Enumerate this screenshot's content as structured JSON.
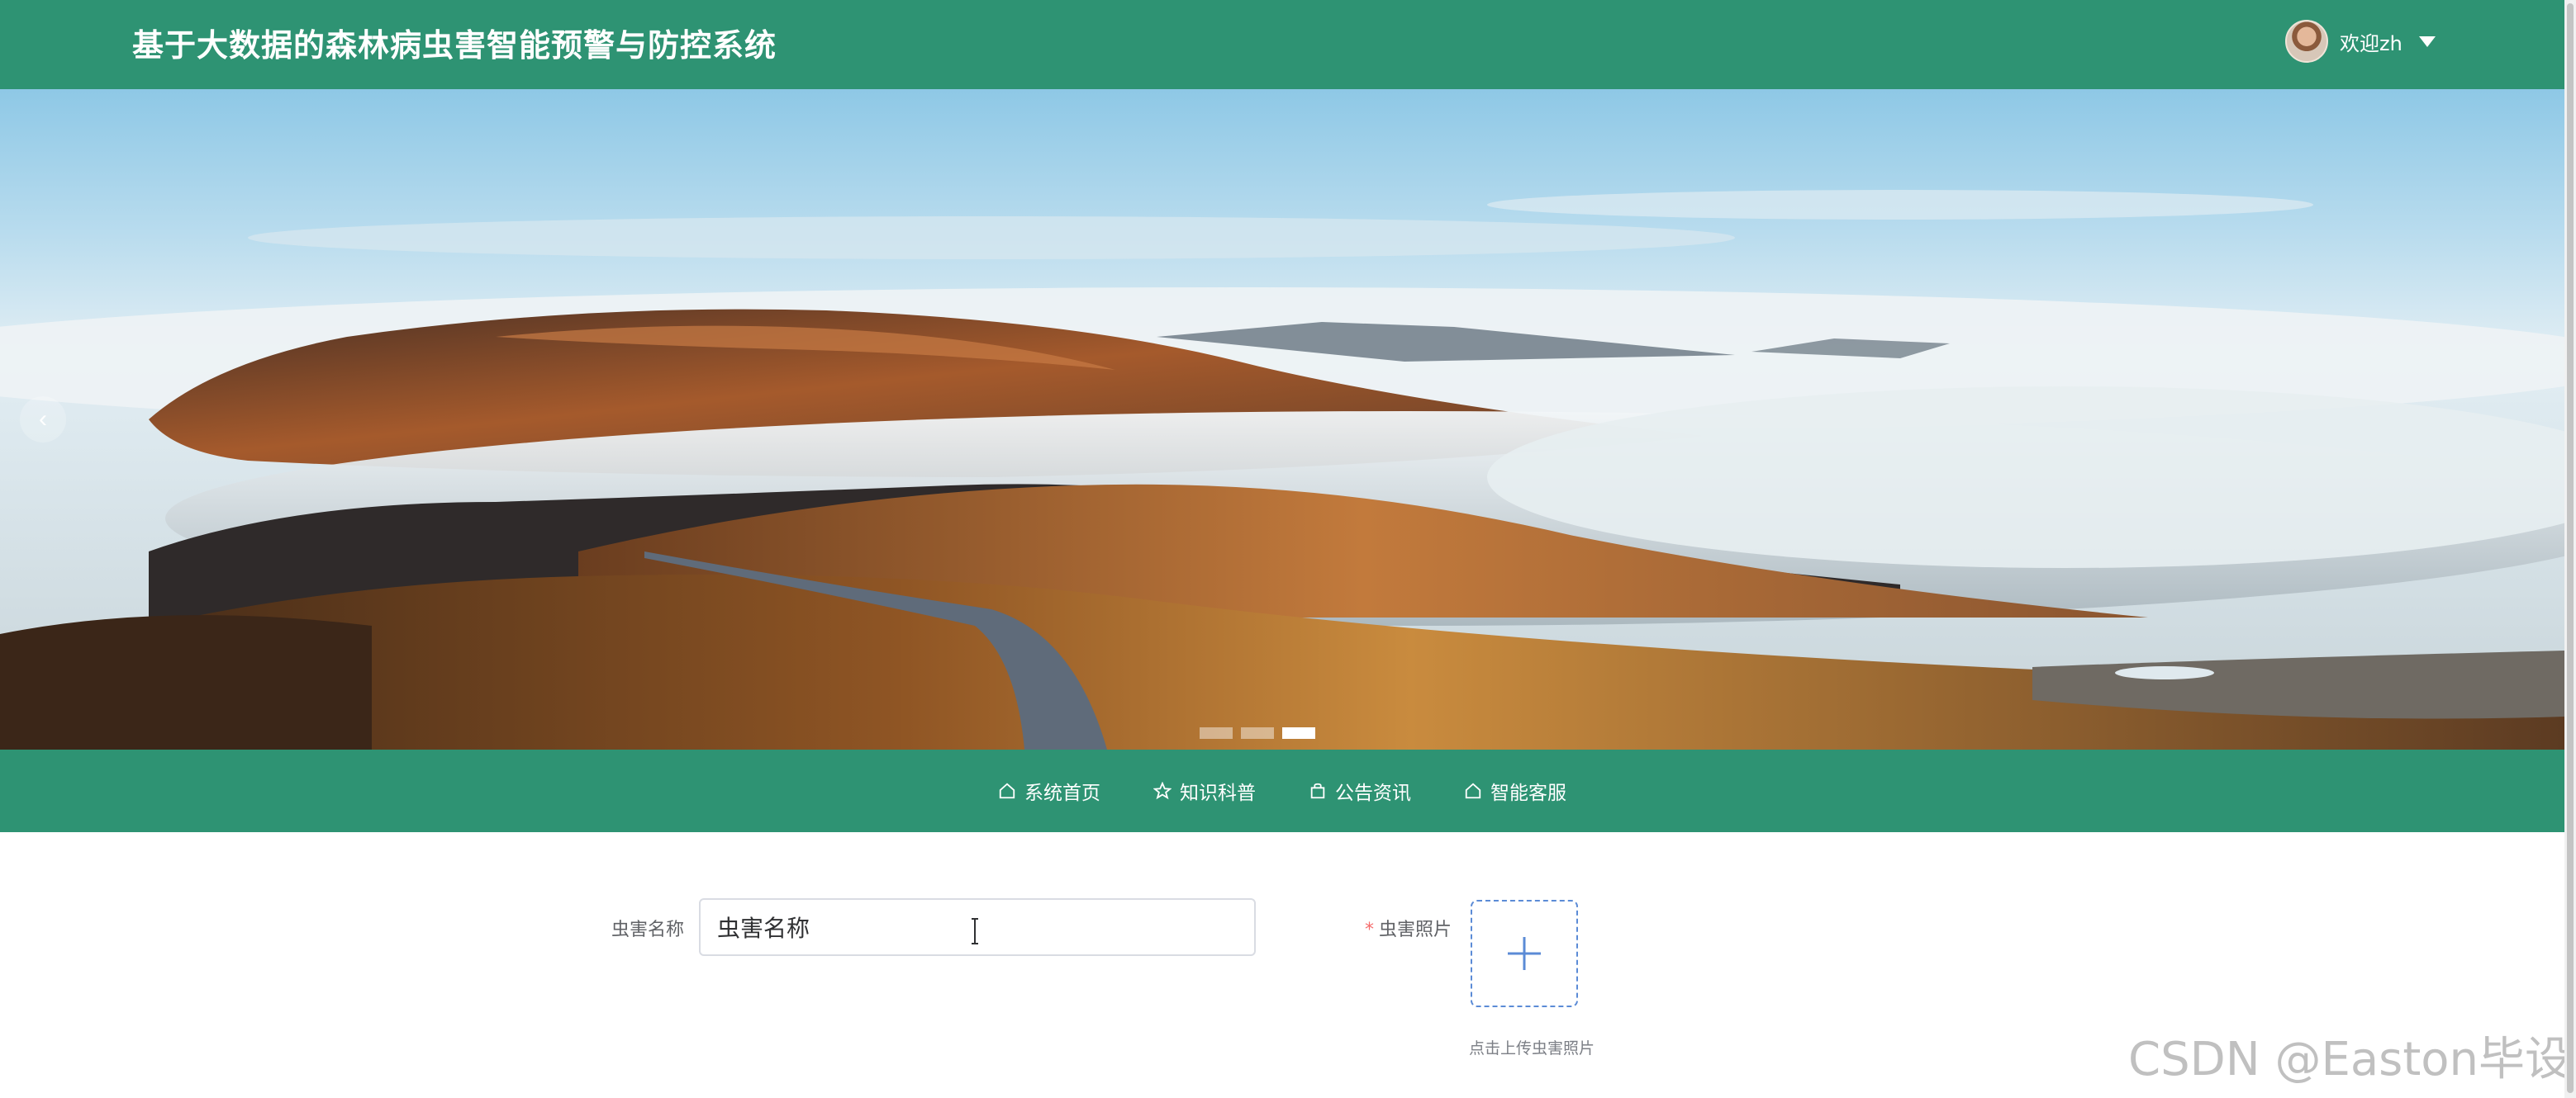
{
  "header": {
    "title": "基于大数据的森林病虫害智能预警与防控系统",
    "welcome": "欢迎zh"
  },
  "banner": {
    "image": "mountain-landscape-with-sea-of-clouds",
    "prev_icon": "‹",
    "slide_count": 3,
    "active_slide": 3
  },
  "nav": {
    "items": [
      {
        "label": "系统首页",
        "icon": "home-icon"
      },
      {
        "label": "知识科普",
        "icon": "star-icon"
      },
      {
        "label": "公告资讯",
        "icon": "bag-icon"
      },
      {
        "label": "智能客服",
        "icon": "home-icon"
      }
    ]
  },
  "form": {
    "name_label": "虫害名称",
    "name_value": "虫害名称",
    "photo_label": "虫害照片",
    "photo_required": "*",
    "upload_hint": "点击上传虫害照片"
  },
  "watermark": "CSDN @Easton毕设",
  "colors": {
    "primary_green": "#2e9373",
    "upload_border": "#5b8bd6",
    "required": "#f56c6c"
  }
}
